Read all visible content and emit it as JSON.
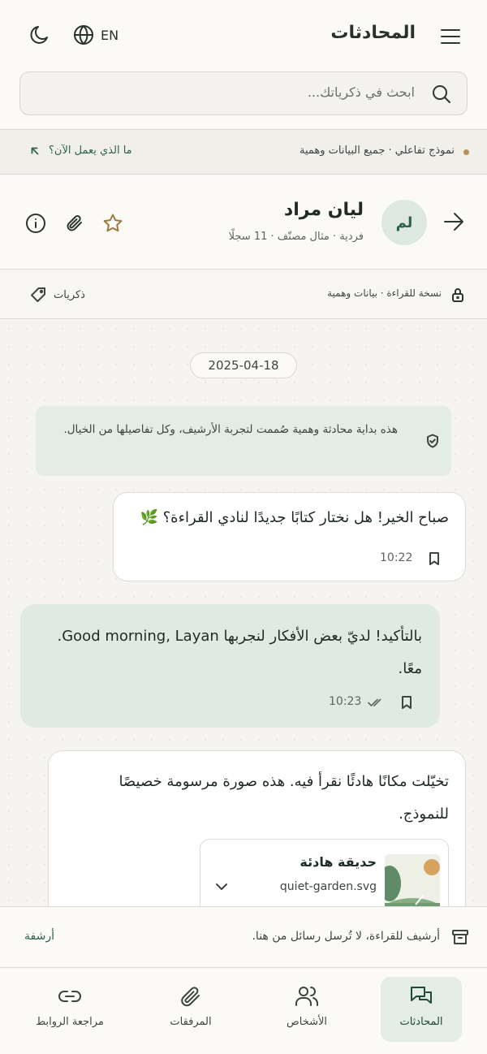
{
  "header": {
    "title": "المحادثات",
    "lang_label": "EN",
    "search_placeholder": "ابحث في ذكرياتك..."
  },
  "banner": {
    "text": "نموذج تفاعلي · جميع البيانات وهمية",
    "link": "ما الذي يعمل الآن؟"
  },
  "contact": {
    "initials": "لم",
    "name": "ليان مراد",
    "meta": "فردية · مثال مصنّف · 11 سجلًا"
  },
  "subbar": {
    "read_only": "نسخة للقراءة · بيانات وهمية",
    "memories": "ذكريات"
  },
  "chat": {
    "date": "2025-04-18",
    "system_note": "هذه بداية محادثة وهمية صُممت لتجربة الأرشيف، وكل تفاصيلها من الخيال.",
    "messages": [
      {
        "text": "صباح الخير! هل نختار كتابًا جديدًا لنادي القراءة؟ 🌿",
        "time": "10:22"
      },
      {
        "text": "بالتأكيد! لديّ بعض الأفكار لنجربها Good morning, Layan. معًا.",
        "time": "10:23"
      },
      {
        "text": "تخيّلت مكانًا هادئًا نقرأ فيه. هذه صورة مرسومة خصيصًا للنموذج."
      }
    ],
    "attachment": {
      "title": "حديقة هادئة",
      "file": "quiet-garden.svg"
    }
  },
  "archive": {
    "text": "أرشيف للقراءة، لا تُرسل رسائل من هنا.",
    "link": "أرشفة"
  },
  "nav": {
    "conversations": "المحادثات",
    "people": "الأشخاص",
    "attachments": "المرفقات",
    "links": "مراجعة الروابط"
  },
  "colors": {
    "accent": "#2d6448",
    "bubble_out": "#dfeae2",
    "star": "#9a7a3e"
  }
}
